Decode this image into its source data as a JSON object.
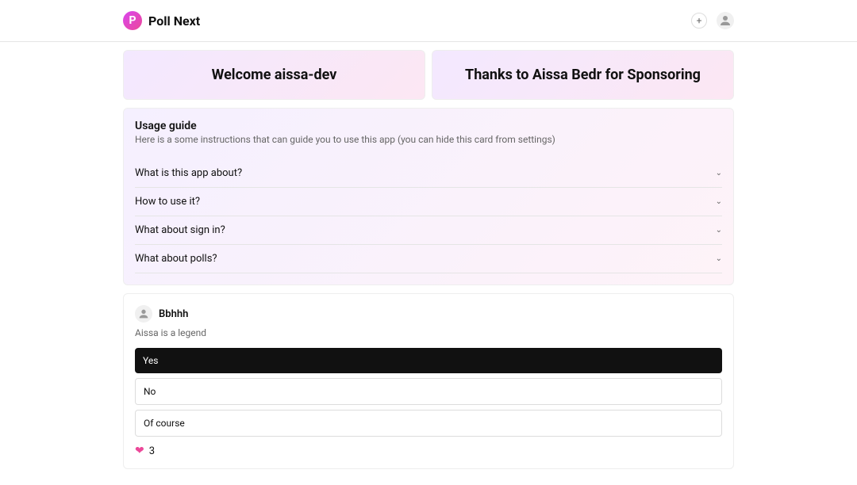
{
  "header": {
    "title": "Poll Next",
    "logo_label": "P"
  },
  "banners": {
    "welcome": "Welcome aissa-dev",
    "thanks": "Thanks to Aissa Bedr for Sponsoring"
  },
  "guide": {
    "title": "Usage guide",
    "description": "Here is a some instructions that can guide you to use this app (you can hide this card from settings)",
    "items": [
      "What is this app about?",
      "How to use it?",
      "What about sign in?",
      "What about polls?"
    ]
  },
  "poll": {
    "author": "Bbhhh",
    "question": "Aissa is a legend",
    "options": [
      {
        "label": "Yes",
        "selected": true
      },
      {
        "label": "No",
        "selected": false
      },
      {
        "label": "Of course",
        "selected": false
      }
    ],
    "likes": "3"
  }
}
